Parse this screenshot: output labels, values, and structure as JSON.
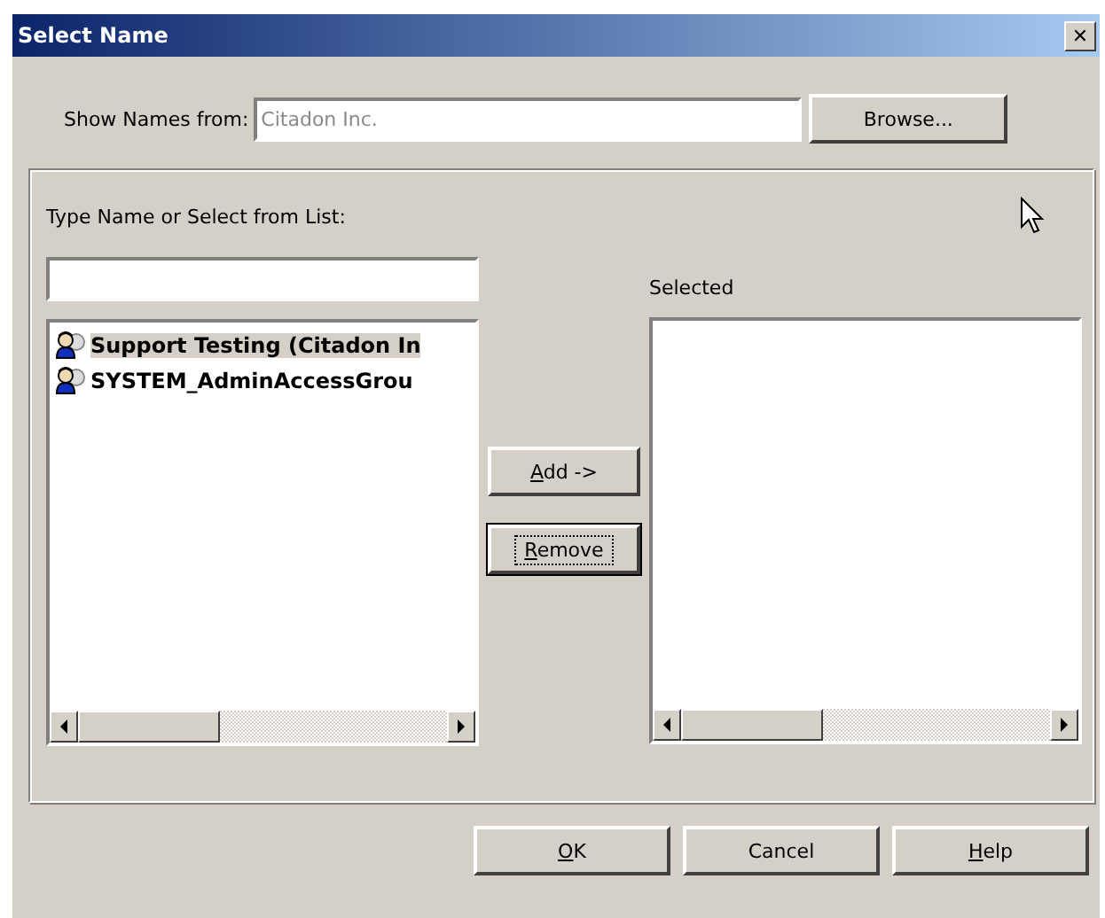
{
  "window": {
    "title": "Select Name",
    "close_glyph": "✕"
  },
  "source": {
    "label": "Show Names from:",
    "value": "Citadon Inc.",
    "disabled": true,
    "browse_button": "Browse..."
  },
  "search": {
    "label": "Type Name or Select from List:"
  },
  "available": {
    "items": [
      {
        "name": "Support Testing (Citadon In",
        "selected": true
      },
      {
        "name": "SYSTEM_AdminAccessGrou",
        "selected": false
      }
    ]
  },
  "move_buttons": [
    {
      "mnemonic": "A",
      "label_rest": "dd ->",
      "focused": false
    },
    {
      "mnemonic": "R",
      "label_rest": "emove",
      "focused": true
    }
  ],
  "selected_list": {
    "label": "Selected"
  },
  "buttons": [
    {
      "mnemonic": "O",
      "label_rest": "K"
    },
    {
      "label_rest": "Cancel"
    },
    {
      "mnemonic": "H",
      "label_rest": "elp"
    }
  ]
}
